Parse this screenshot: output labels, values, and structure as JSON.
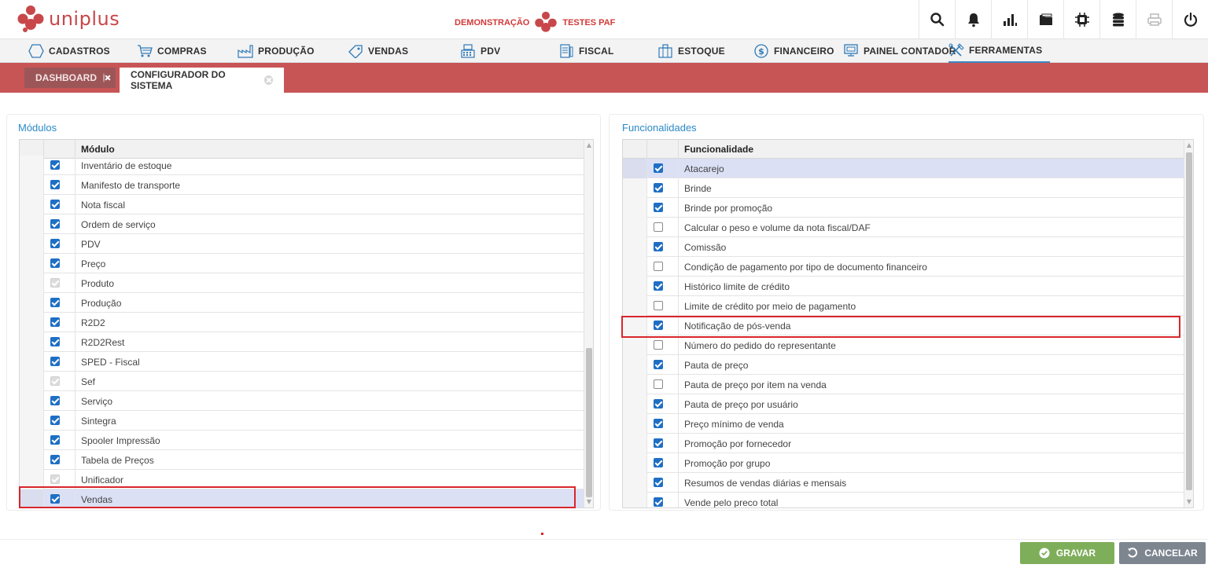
{
  "app": {
    "logo_text": "uniplus",
    "environment_left": "DEMONSTRAÇÃO",
    "environment_right": "TESTES PAF",
    "top_icons": [
      "search-icon",
      "bell-icon",
      "chart-icon",
      "folder-icon",
      "cpu-icon",
      "database-icon",
      "printer-icon",
      "power-icon"
    ]
  },
  "menu": {
    "items": [
      {
        "label": "CADASTROS",
        "icon": "hexagon-icon"
      },
      {
        "label": "COMPRAS",
        "icon": "cart-icon"
      },
      {
        "label": "PRODUÇÃO",
        "icon": "factory-icon"
      },
      {
        "label": "VENDAS",
        "icon": "tag-icon"
      },
      {
        "label": "PDV",
        "icon": "register-icon"
      },
      {
        "label": "FISCAL",
        "icon": "document-icon"
      },
      {
        "label": "ESTOQUE",
        "icon": "box-icon"
      },
      {
        "label": "FINANCEIRO",
        "icon": "dollar-icon"
      },
      {
        "label": "PAINEL CONTADOR",
        "icon": "monitor-icon"
      },
      {
        "label": "FERRAMENTAS",
        "icon": "tools-icon"
      }
    ],
    "active": "FERRAMENTAS"
  },
  "tabs": [
    {
      "label": "DASHBOARD",
      "active": false
    },
    {
      "label": "CONFIGURADOR DO SISTEMA",
      "active": true
    }
  ],
  "modules": {
    "title": "Módulos",
    "column_header": "Módulo",
    "rows": [
      {
        "label": "Inventário de estoque",
        "state": "on"
      },
      {
        "label": "Manifesto de transporte",
        "state": "on"
      },
      {
        "label": "Nota fiscal",
        "state": "on"
      },
      {
        "label": "Ordem de serviço",
        "state": "on"
      },
      {
        "label": "PDV",
        "state": "on"
      },
      {
        "label": "Preço",
        "state": "on"
      },
      {
        "label": "Produto",
        "state": "disabled"
      },
      {
        "label": "Produção",
        "state": "on"
      },
      {
        "label": "R2D2",
        "state": "on"
      },
      {
        "label": "R2D2Rest",
        "state": "on"
      },
      {
        "label": "SPED - Fiscal",
        "state": "on"
      },
      {
        "label": "Sef",
        "state": "disabled"
      },
      {
        "label": "Serviço",
        "state": "on"
      },
      {
        "label": "Sintegra",
        "state": "on"
      },
      {
        "label": "Spooler Impressão",
        "state": "on"
      },
      {
        "label": "Tabela de Preços",
        "state": "on"
      },
      {
        "label": "Unificador",
        "state": "disabled"
      },
      {
        "label": "Vendas",
        "state": "on",
        "selected": true
      }
    ]
  },
  "features": {
    "title": "Funcionalidades",
    "column_header": "Funcionalidade",
    "rows": [
      {
        "label": "Atacarejo",
        "state": "on",
        "selected": true
      },
      {
        "label": "Brinde",
        "state": "on"
      },
      {
        "label": "Brinde por promoção",
        "state": "on"
      },
      {
        "label": "Calcular o peso e volume da nota fiscal/DAF",
        "state": "off"
      },
      {
        "label": "Comissão",
        "state": "on"
      },
      {
        "label": "Condição de pagamento por tipo de documento financeiro",
        "state": "off"
      },
      {
        "label": "Histórico limite de crédito",
        "state": "on"
      },
      {
        "label": "Limite de crédito por meio de pagamento",
        "state": "off"
      },
      {
        "label": "Notificação de pós-venda",
        "state": "on"
      },
      {
        "label": "Número do pedido do representante",
        "state": "off"
      },
      {
        "label": "Pauta de preço",
        "state": "on"
      },
      {
        "label": "Pauta de preço por item na venda",
        "state": "off"
      },
      {
        "label": "Pauta de preço por usuário",
        "state": "on"
      },
      {
        "label": "Preço mínimo de venda",
        "state": "on"
      },
      {
        "label": "Promoção por fornecedor",
        "state": "on"
      },
      {
        "label": "Promoção por grupo",
        "state": "on"
      },
      {
        "label": "Resumos de vendas diárias e mensais",
        "state": "on"
      },
      {
        "label": "Vende pelo preco total",
        "state": "on"
      }
    ]
  },
  "actions": {
    "save_label": "GRAVAR",
    "cancel_label": "CANCELAR"
  },
  "colors": {
    "brand": "#c8474a",
    "tabbar": "#c85556",
    "accent_blue": "#2a89c8",
    "save": "#7fae5b",
    "cancel": "#7d858f"
  }
}
